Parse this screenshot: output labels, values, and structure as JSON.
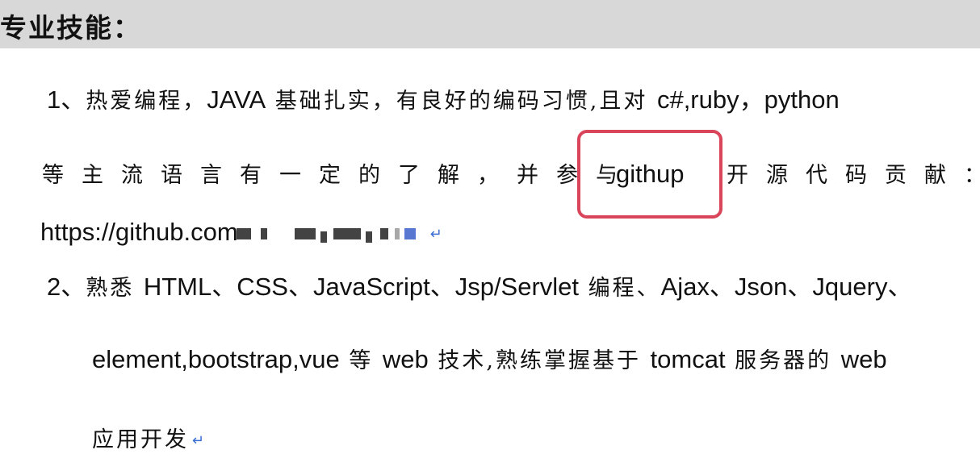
{
  "section": {
    "title": "专业技能："
  },
  "item1": {
    "number": "1、",
    "text_a": "热爱编程，",
    "java": "JAVA",
    "text_b": " 基础扎实，有良好的编码习惯,",
    "text_c": "且对 ",
    "langs": "c#,ruby，python",
    "line2_a": "等主流语言有一定的了解，并参与",
    "github_word": "githup",
    "line2_b": "开源代码贡献：",
    "url_visible": "https://github.com"
  },
  "item2": {
    "number": "2、",
    "text_a": "熟悉 ",
    "techs": "HTML、CSS、JavaScript、Jsp/Servlet",
    "text_b": " 编程、",
    "techs2": "Ajax、Json、Jquery、",
    "line2_a": "element,bootstrap,vue",
    "line2_b": " 等 ",
    "line2_c": "web",
    "line2_d": " 技术,熟练掌握基于 ",
    "line2_e": "tomcat",
    "line2_f": " 服务器的 ",
    "line2_g": "web",
    "line3": "应用开发"
  },
  "colors": {
    "header_bg": "#d8d8d8",
    "highlight_border": "#d9455a",
    "paragraph_mark": "#3b6fd6"
  }
}
